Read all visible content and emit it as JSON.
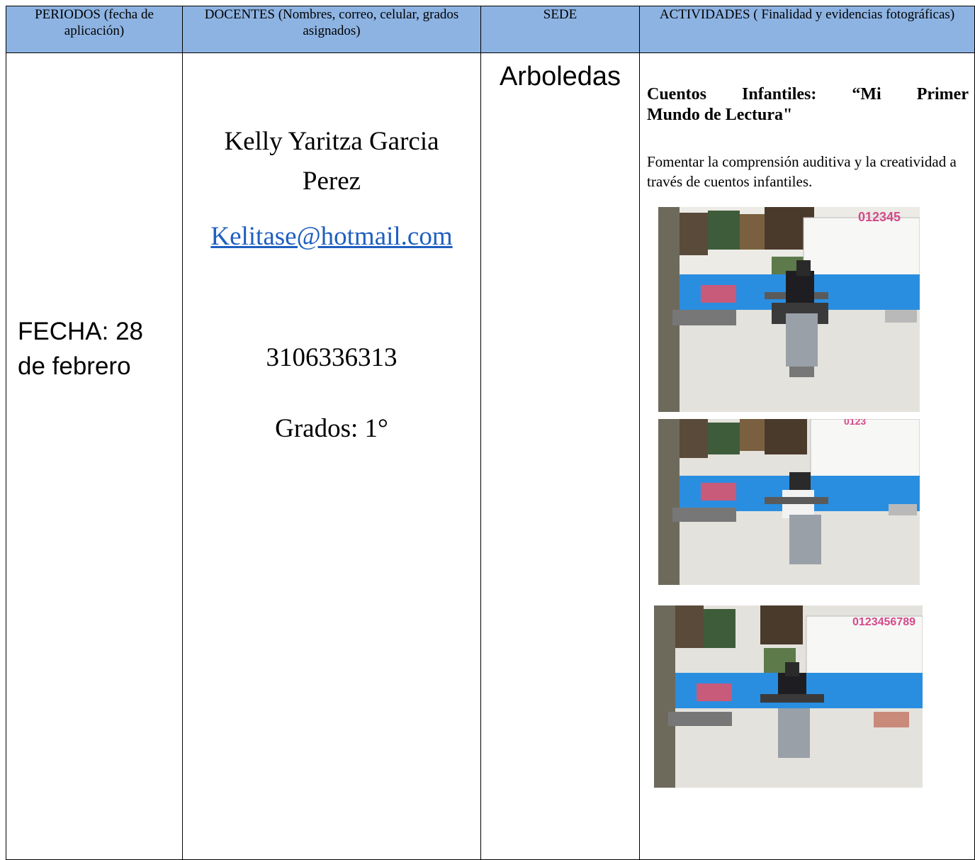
{
  "headers": {
    "periodos": "PERIODOS (fecha de aplicación)",
    "docentes": "DOCENTES (Nombres, correo, celular, grados asignados)",
    "sede": "SEDE",
    "actividades": "ACTIVIDADES ( Finalidad y evidencias fotográficas)"
  },
  "periodo": {
    "line1": "FECHA: 28",
    "line2": "de febrero"
  },
  "docente": {
    "name_line1": "Kelly Yaritza Garcia",
    "name_line2": "Perez",
    "email": "Kelitase@hotmail.com",
    "phone": "3106336313",
    "grados": "Grados: 1°"
  },
  "sede": {
    "name": "Arboledas"
  },
  "actividad": {
    "title_w1": "Cuentos",
    "title_w2": "Infantiles:",
    "title_w3": "“Mi",
    "title_w4": "Primer",
    "title_line2": "Mundo de Lectura\"",
    "description": "Fomentar la comprensión auditiva y la creatividad a través de cuentos infantiles.",
    "photos": [
      {
        "icon": "classroom-photo",
        "wall_numbers": "012345"
      },
      {
        "icon": "classroom-photo",
        "wall_numbers": "0123"
      },
      {
        "icon": "classroom-photo",
        "wall_numbers": "0123456789"
      }
    ]
  },
  "colors": {
    "header_bg": "#8db3e2",
    "link": "#1f5fbf",
    "wall_blue": "#2a8ee0"
  }
}
